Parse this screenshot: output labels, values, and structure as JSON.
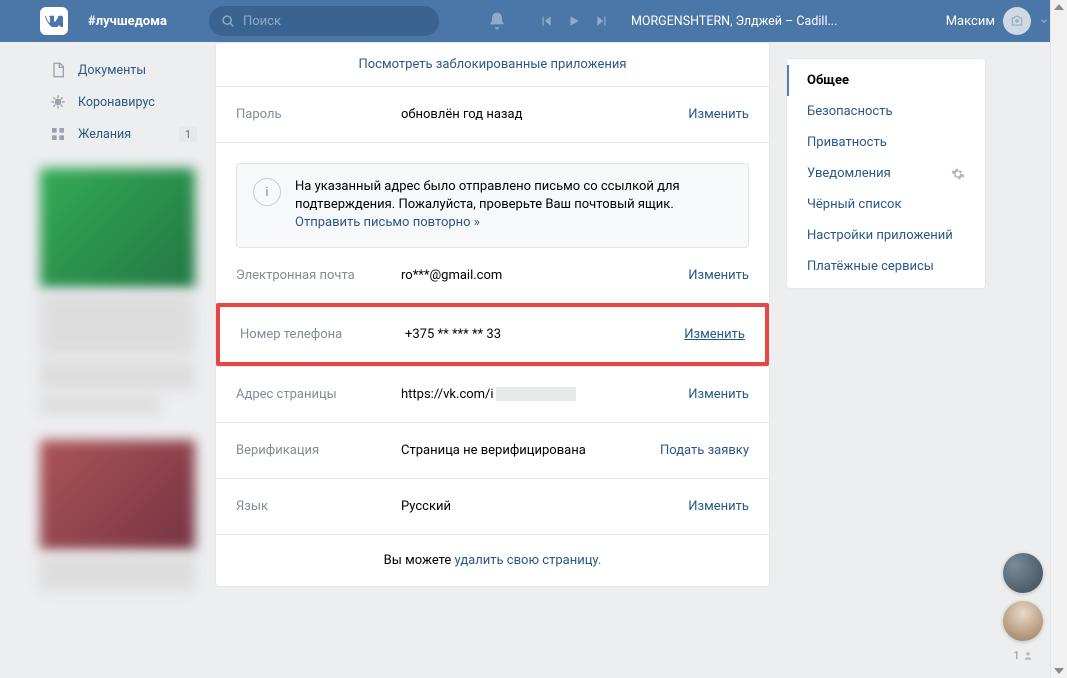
{
  "header": {
    "hashtag": "#лучшедома",
    "search_placeholder": "Поиск",
    "track": "MORGENSHTERN, Элджей – Cadill...",
    "username": "Максим"
  },
  "sidebar": {
    "items": [
      {
        "label": "Документы"
      },
      {
        "label": "Коронавирус"
      },
      {
        "label": "Желания",
        "badge": "1"
      }
    ]
  },
  "settings": {
    "apps_link": "Посмотреть заблокированные приложения",
    "password": {
      "label": "Пароль",
      "value": "обновлён год назад",
      "action": "Изменить"
    },
    "emailbox": {
      "line1": "На указанный адрес было отправлено письмо со ссылкой для подтверждения. Пожалуйста, проверьте Ваш почтовый ящик.",
      "resend": "Отправить письмо повторно »"
    },
    "email": {
      "label": "Электронная почта",
      "value": "ro***@gmail.com",
      "action": "Изменить"
    },
    "phone": {
      "label": "Номер телефона",
      "value": "+375 ** *** ** 33",
      "action": "Изменить"
    },
    "address": {
      "label": "Адрес страницы",
      "value": "https://vk.com/i",
      "action": "Изменить"
    },
    "verification": {
      "label": "Верификация",
      "value": "Страница не верифицирована",
      "action": "Подать заявку"
    },
    "language": {
      "label": "Язык",
      "value": "Русский",
      "action": "Изменить"
    },
    "delete_prefix": "Вы можете ",
    "delete_link": "удалить свою страницу."
  },
  "rightmenu": {
    "items": [
      "Общее",
      "Безопасность",
      "Приватность",
      "Уведомления",
      "Чёрный список",
      "Настройки приложений",
      "Платёжные сервисы"
    ]
  },
  "float_count": "1"
}
